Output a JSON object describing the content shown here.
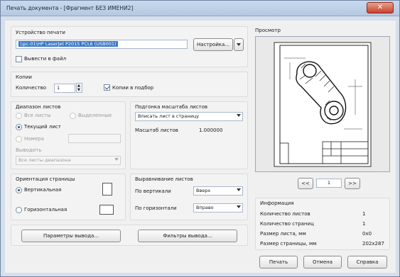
{
  "window": {
    "title": "Печать документа - [Фрагмент БЕЗ ИМЕНИ2]",
    "close_glyph": "✕"
  },
  "printer": {
    "group_label": "Устройство печати",
    "selected": "\\\\pc-01\\HP LaserJet P2015 PCL6 (USB001)",
    "settings_label": "Настройка...",
    "print_to_file_label": "Вывести в файл",
    "print_to_file_checked": false
  },
  "copies": {
    "group_label": "Копии",
    "count_label": "Количество",
    "count_value": "1",
    "collate_label": "Копии в подбор",
    "collate_checked": true
  },
  "range": {
    "group_label": "Диапазон листов",
    "all_label": "Все листы",
    "selection_label": "Выделенные",
    "current_label": "Текущий лист",
    "numbers_label": "Номера",
    "output_label": "Выводить",
    "output_value": "Все листы диапазона",
    "selected_option": "current"
  },
  "fit": {
    "group_label": "Подгонка масштаба листов",
    "mode_value": "Вписать лист в страницу",
    "scale_label": "Масштаб листов",
    "scale_value": "1.000000"
  },
  "orientation": {
    "group_label": "Ориентация страницы",
    "portrait_label": "Вертикальная",
    "landscape_label": "Горизонтальная",
    "selected": "portrait"
  },
  "align": {
    "group_label": "Выравнивание листов",
    "vertical_label": "По вертикали",
    "vertical_value": "Вверх",
    "horizontal_label": "По горизонтали",
    "horizontal_value": "Вправо"
  },
  "buttons": {
    "output_params": "Параметры вывода...",
    "output_filters": "Фильтры вывода...",
    "print": "Печать",
    "cancel": "Отмена",
    "help": "Справка"
  },
  "preview": {
    "label": "Просмотр",
    "prev": "<<",
    "page": "1",
    "next": ">>"
  },
  "info": {
    "label": "Информация",
    "rows": [
      {
        "name": "Количество листов",
        "value": "1"
      },
      {
        "name": "Количество страниц",
        "value": "1"
      },
      {
        "name": "Размер листа, мм",
        "value": "0x0"
      },
      {
        "name": "Размер страницы, мм",
        "value": "202x287"
      }
    ]
  }
}
